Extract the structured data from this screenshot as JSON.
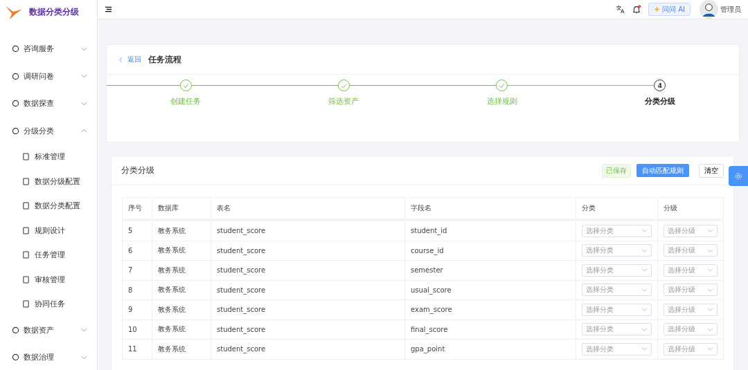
{
  "app": {
    "title": "数据分类分级"
  },
  "sidebar": {
    "items": [
      {
        "label": "咨询服务",
        "expanded": false
      },
      {
        "label": "调研问卷",
        "expanded": false
      },
      {
        "label": "数据探查",
        "expanded": false
      },
      {
        "label": "分级分类",
        "expanded": true,
        "children": [
          {
            "label": "标准管理"
          },
          {
            "label": "数据分级配置"
          },
          {
            "label": "数据分类配置"
          },
          {
            "label": "规则设计"
          },
          {
            "label": "任务管理"
          },
          {
            "label": "审核管理"
          },
          {
            "label": "协同任务"
          }
        ]
      },
      {
        "label": "数据资产",
        "expanded": false
      },
      {
        "label": "数据治理",
        "expanded": false
      }
    ]
  },
  "header": {
    "ai_button": "问问 AI",
    "user": "管理员",
    "notification_unread": true
  },
  "page": {
    "back": "返回",
    "title": "任务流程"
  },
  "steps": [
    {
      "label": "创建任务",
      "done": true
    },
    {
      "label": "筛选资产",
      "done": true
    },
    {
      "label": "选择规则",
      "done": true
    },
    {
      "label": "分类分级",
      "done": false,
      "number": "4"
    }
  ],
  "panel": {
    "title": "分类分级",
    "saved_tag": "已保存",
    "auto_button": "自动匹配规则",
    "clear_button": "清空"
  },
  "table": {
    "columns": [
      "序号",
      "数据库",
      "表名",
      "字段名",
      "分类",
      "分级"
    ],
    "rows": [
      {
        "no": "5",
        "db": "教务系统",
        "table": "student_score",
        "field": "student_id",
        "category": "选择分类",
        "level": "选择分级"
      },
      {
        "no": "6",
        "db": "教务系统",
        "table": "student_score",
        "field": "course_id",
        "category": "选择分类",
        "level": "选择分级"
      },
      {
        "no": "7",
        "db": "教务系统",
        "table": "student_score",
        "field": "semester",
        "category": "选择分类",
        "level": "选择分级"
      },
      {
        "no": "8",
        "db": "教务系统",
        "table": "student_score",
        "field": "usual_score",
        "category": "选择分类",
        "level": "选择分级"
      },
      {
        "no": "9",
        "db": "教务系统",
        "table": "student_score",
        "field": "exam_score",
        "category": "选择分类",
        "level": "选择分级"
      },
      {
        "no": "10",
        "db": "教务系统",
        "table": "student_score",
        "field": "final_score",
        "category": "选择分类",
        "level": "选择分级"
      },
      {
        "no": "11",
        "db": "教务系统",
        "table": "student_score",
        "field": "gpa_point",
        "category": "选择分类",
        "level": "选择分级"
      }
    ]
  }
}
